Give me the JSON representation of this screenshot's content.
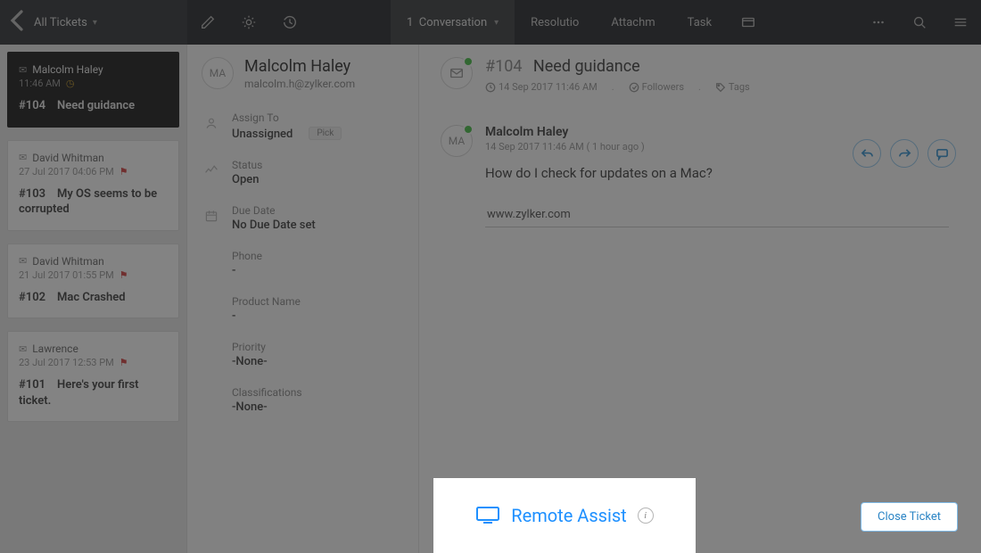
{
  "topbar": {
    "left_label": "All Tickets",
    "tabs": {
      "conversation_count": "1",
      "conversation_label": "Conversation",
      "resolution_label": "Resolutio",
      "attachment_label": "Attachm",
      "task_label": "Task"
    }
  },
  "tickets": [
    {
      "name": "Malcolm Haley",
      "meta": "11:46 AM",
      "id": "#104",
      "subject": "Need guidance",
      "active": true
    },
    {
      "name": "David Whitman",
      "meta": "27 Jul 2017 04:06 PM",
      "id": "#103",
      "subject": "My OS seems to be corrupted",
      "flag": "red"
    },
    {
      "name": "David Whitman",
      "meta": "21 Jul 2017 01:55 PM",
      "id": "#102",
      "subject": "Mac Crashed",
      "flag": "red"
    },
    {
      "name": "Lawrence",
      "meta": "23 Jul 2017 12:53 PM",
      "id": "#101",
      "subject": "Here's your first ticket.",
      "flag": "red"
    }
  ],
  "contact": {
    "initials": "MA",
    "name": "Malcolm Haley",
    "email": "malcolm.h@zylker.com"
  },
  "props": {
    "assign_label": "Assign To",
    "assign_value": "Unassigned",
    "pick_label": "Pick",
    "status_label": "Status",
    "status_value": "Open",
    "due_label": "Due Date",
    "due_value": "No Due Date set",
    "phone_label": "Phone",
    "phone_value": "-",
    "product_label": "Product Name",
    "product_value": "-",
    "priority_label": "Priority",
    "priority_value": "-None-",
    "class_label": "Classifications",
    "class_value": "-None-"
  },
  "conversation": {
    "id": "#104",
    "subject": "Need guidance",
    "timestamp": "14 Sep 2017 11:46 AM",
    "followers_label": "Followers",
    "tags_label": "Tags",
    "message": {
      "initials": "MA",
      "author": "Malcolm Haley",
      "time": "14 Sep 2017 11:46 AM ( 1 hour ago )",
      "body": "How do I check for updates on a Mac?"
    },
    "url_value": "www.zylker.com"
  },
  "highlight": {
    "label": "Remote Assist"
  },
  "close_ticket_label": "Close Ticket"
}
